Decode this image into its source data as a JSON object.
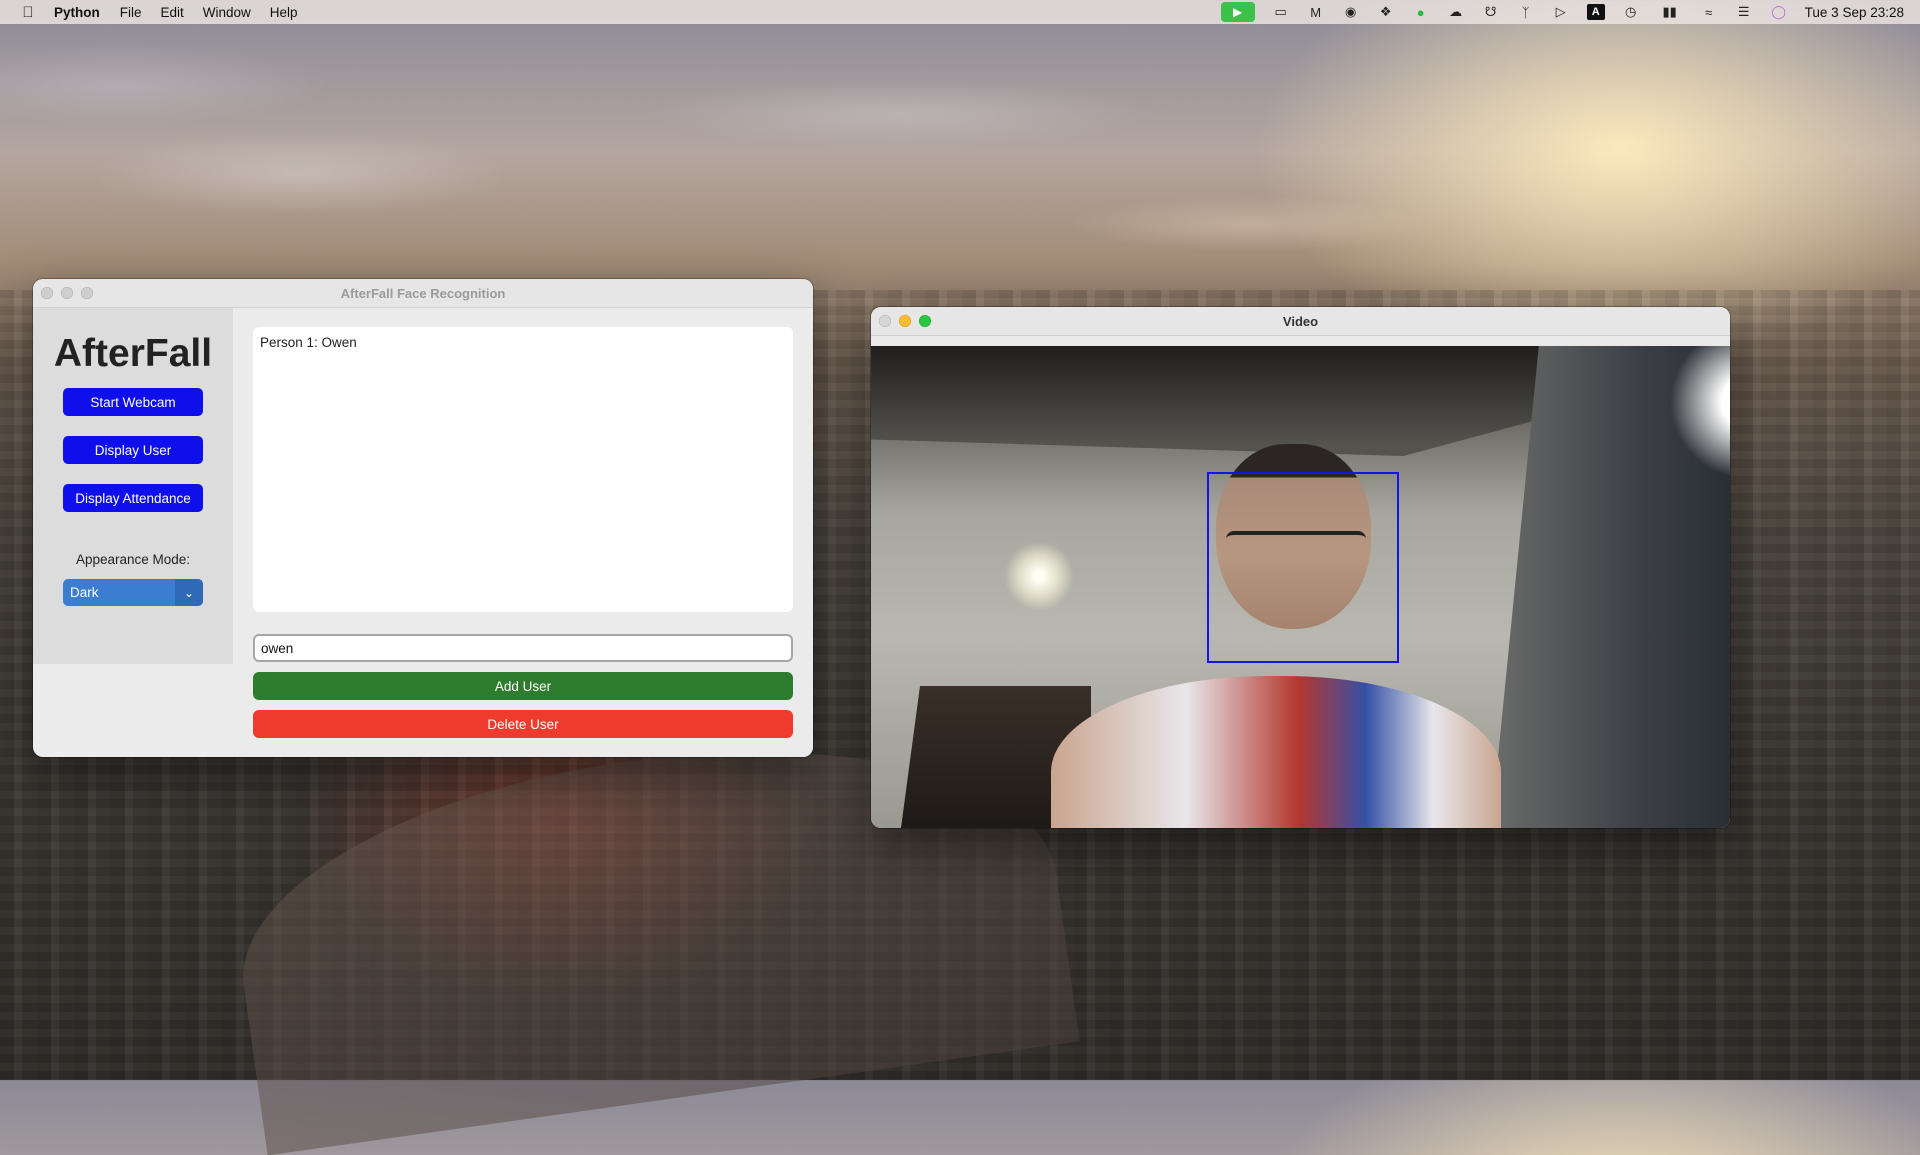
{
  "menubar": {
    "app_name": "Python",
    "menus": [
      "File",
      "Edit",
      "Window",
      "Help"
    ],
    "status_icons": [
      "facetime-icon",
      "clipboard-icon",
      "malwarebytes-icon",
      "creative-cloud-icon",
      "gear-diamond-icon",
      "line-icon",
      "cloud-icon",
      "headphones-icon",
      "bluetooth-icon",
      "play-circle-icon",
      "keyboard-input-icon",
      "time-machine-icon",
      "battery-icon",
      "wifi-icon",
      "control-center-icon",
      "siri-icon"
    ],
    "input_source": "A",
    "clock": "Tue 3 Sep  23:28"
  },
  "app_window": {
    "title": "AfterFall Face Recognition",
    "brand": "AfterFall",
    "buttons": {
      "start_webcam": "Start Webcam",
      "display_user": "Display User",
      "display_attendance": "Display Attendance"
    },
    "appearance_label": "Appearance Mode:",
    "appearance_value": "Dark",
    "output_text": "Person 1: Owen",
    "entry_value": "owen",
    "add_user": "Add User",
    "delete_user": "Delete User",
    "colors": {
      "primary_button": "#0f0feb",
      "add_button": "#2e7d2e",
      "delete_button": "#ee3b2e",
      "select": "#3b7dd0"
    }
  },
  "video_window": {
    "title": "Video",
    "face_box_color": "#1414e6"
  }
}
